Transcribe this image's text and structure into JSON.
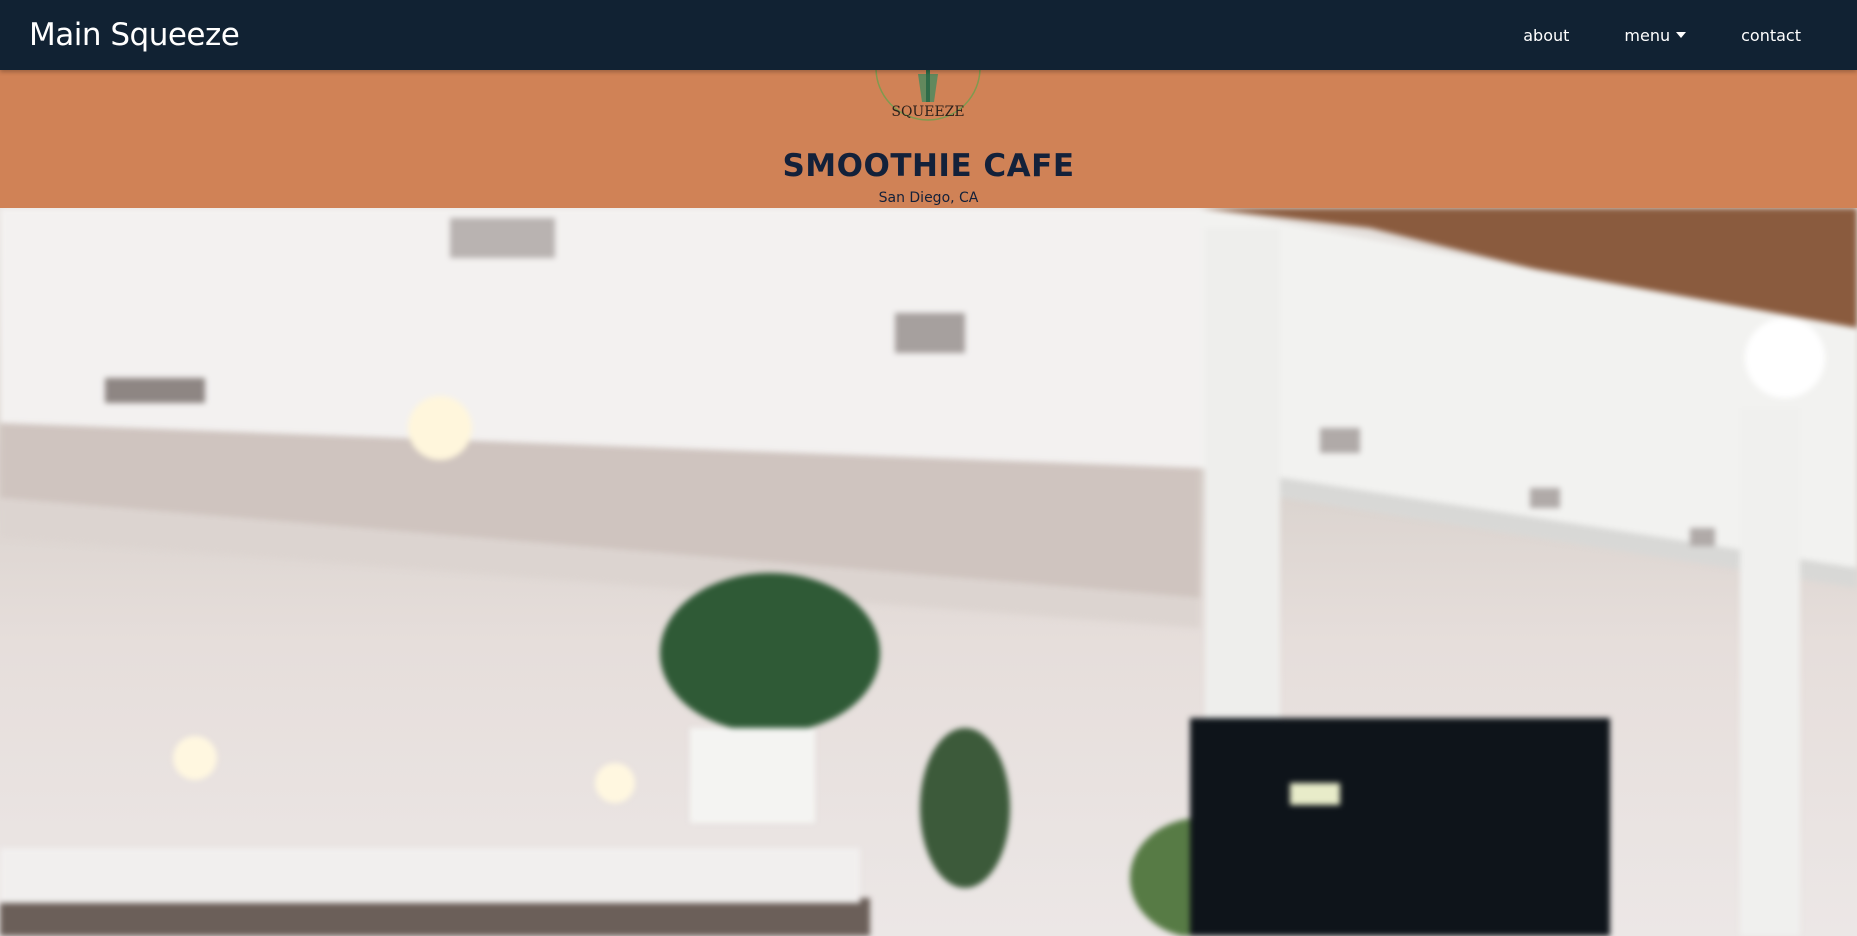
{
  "nav": {
    "brand": "Main Squeeze",
    "links": [
      {
        "label": "about"
      },
      {
        "label": "menu"
      },
      {
        "label": "contact"
      }
    ]
  },
  "banner": {
    "logo_text": "SQUEEZE",
    "title": "SMOOTHIE CAFE",
    "subtitle": "San Diego, CA"
  },
  "colors": {
    "navbar": "#112233",
    "banner": "#d08256",
    "title": "#13213a"
  },
  "icons": {
    "menu_caret": "caret-down-icon"
  }
}
